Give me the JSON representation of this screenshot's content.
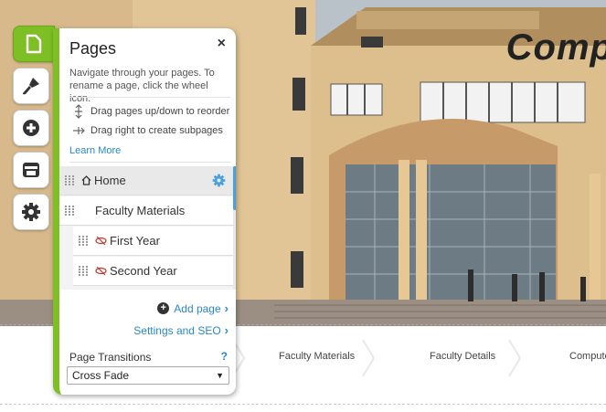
{
  "site": {
    "hero_title": "Comp",
    "nav": [
      "Faculty Materials",
      "Faculty Details",
      "Compute"
    ]
  },
  "rail": {
    "items": [
      {
        "name": "pages",
        "icon": "page-icon",
        "active": true
      },
      {
        "name": "design",
        "icon": "paintbrush-icon",
        "active": false
      },
      {
        "name": "add",
        "icon": "plus-circle-icon",
        "active": false
      },
      {
        "name": "store",
        "icon": "store-icon",
        "active": false
      },
      {
        "name": "settings",
        "icon": "gear-icon",
        "active": false
      }
    ]
  },
  "panel": {
    "title": "Pages",
    "close": "×",
    "description": "Navigate through your pages. To rename a page, click the wheel icon.",
    "hint_reorder": "Drag pages up/down to reorder",
    "hint_subpages": "Drag right to create subpages",
    "learn_more": "Learn More",
    "pages": [
      {
        "label": "Home",
        "icon": "home-icon",
        "selected": true,
        "level": 0
      },
      {
        "label": "Faculty Materials",
        "level": 0
      },
      {
        "label": "First Year",
        "icon": "hidden-eye-icon",
        "level": 1
      },
      {
        "label": "Second Year",
        "icon": "hidden-eye-icon",
        "level": 1
      }
    ],
    "add_page": "Add page",
    "settings_seo": "Settings and SEO",
    "arrow": "›",
    "plus": "+",
    "transitions_label": "Page Transitions",
    "help": "?",
    "transition_value": "Cross Fade",
    "caret": "▼"
  },
  "colors": {
    "accent_green": "#7dbf24",
    "link_blue": "#2a87c8"
  }
}
